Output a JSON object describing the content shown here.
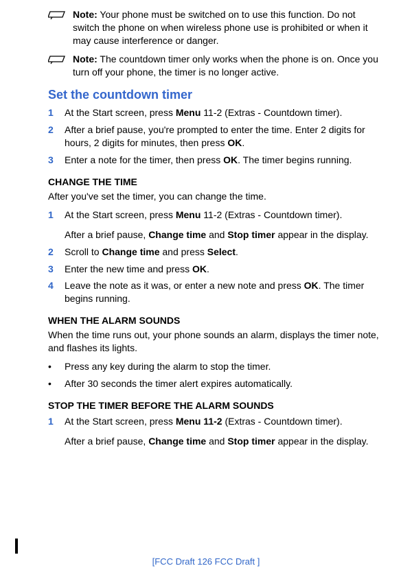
{
  "notes": [
    {
      "label": "Note:",
      "text": "Your phone must be switched on to use this function. Do not switch the phone on when wireless phone use is prohibited or when it may cause interference or danger."
    },
    {
      "label": "Note:",
      "text": "The countdown timer only works when the phone is on. Once you turn off your phone, the timer is no longer active."
    }
  ],
  "section_title": "Set the countdown timer",
  "steps1": [
    {
      "n": "1",
      "pre": "At the Start screen, press ",
      "b": "Menu",
      "post": " 11-2 (Extras - Countdown timer)."
    },
    {
      "n": "2",
      "pre": "After a brief pause, you're prompted to enter the time. Enter 2 digits for hours, 2 digits for minutes, then press ",
      "b": "OK",
      "post": "."
    },
    {
      "n": "3",
      "pre": "Enter a note for the timer, then press ",
      "b": "OK",
      "post": ". The timer begins running."
    }
  ],
  "sub1": "CHANGE THE TIME",
  "sub1_intro": "After you've set the timer, you can change the time.",
  "steps2_1": {
    "n": "1",
    "pre": "At the Start screen, press ",
    "b": "Menu",
    "post": " 11-2 (Extras - Countdown timer)."
  },
  "steps2_1_after": {
    "pre": "After a brief pause, ",
    "b1": "Change time",
    "mid": " and ",
    "b2": "Stop timer",
    "post": " appear in the display."
  },
  "steps2_2": {
    "n": "2",
    "pre": "Scroll to ",
    "b": "Change time",
    "mid": " and press ",
    "b2": "Select",
    "post": "."
  },
  "steps2_3": {
    "n": "3",
    "pre": "Enter the new time and press ",
    "b": "OK",
    "post": "."
  },
  "steps2_4": {
    "n": "4",
    "pre": "Leave the note as it was, or enter a new note and press ",
    "b": "OK",
    "post": ". The timer begins running."
  },
  "sub2": "WHEN THE ALARM SOUNDS",
  "sub2_intro": "When the time runs out, your phone sounds an alarm, displays the timer note, and flashes its lights.",
  "bullets": [
    "Press any key during the alarm to stop the timer.",
    "After 30 seconds the timer alert expires automatically."
  ],
  "sub3": "STOP THE TIMER BEFORE THE ALARM SOUNDS",
  "steps3_1": {
    "n": "1",
    "pre": "At the Start screen, press ",
    "b": "Menu 11-2",
    "post": " (Extras - Countdown timer)."
  },
  "steps3_1_after": {
    "pre": "After a brief pause, ",
    "b1": "Change time",
    "mid": " and ",
    "b2": "Stop timer",
    "post": " appear in the display."
  },
  "footer": "[FCC Draft    126   FCC Draft ]"
}
